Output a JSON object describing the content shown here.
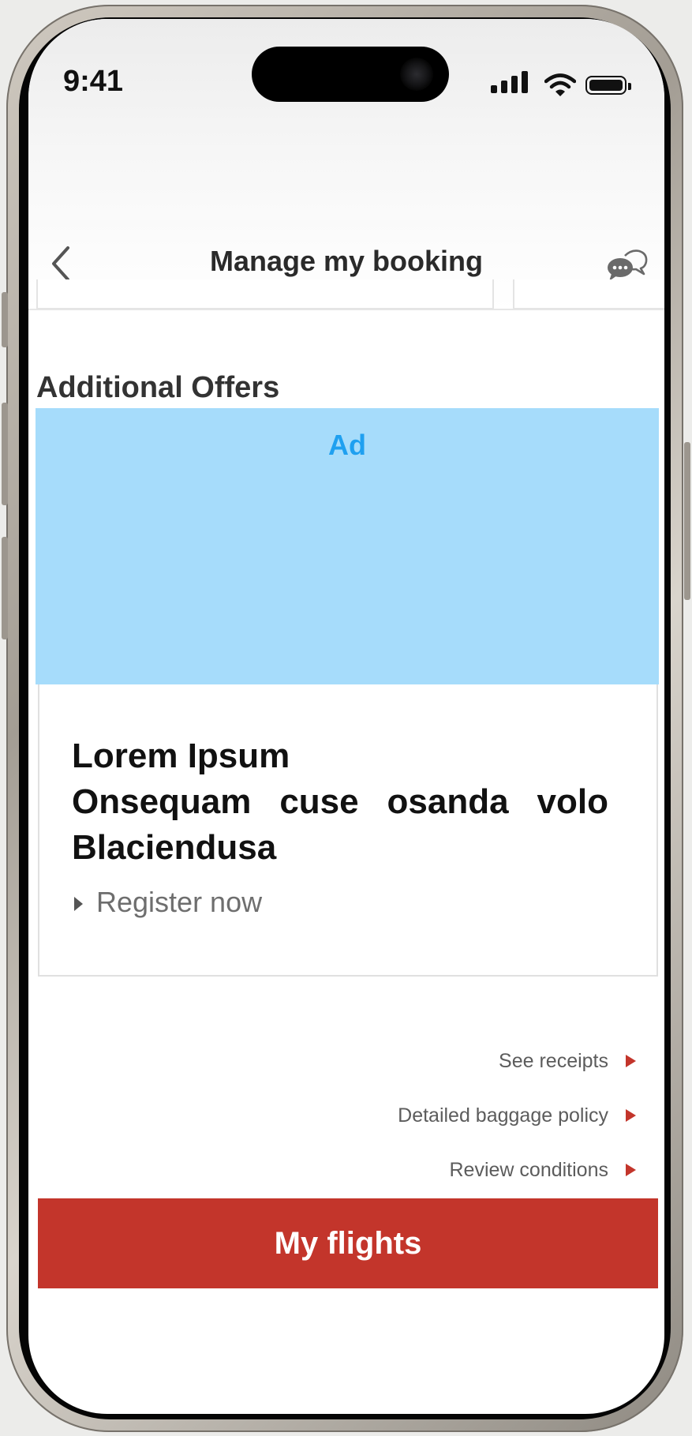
{
  "status_bar": {
    "time": "9:41",
    "icons": [
      "cellular-signal-icon",
      "wifi-icon",
      "battery-icon"
    ]
  },
  "nav": {
    "title": "Manage my booking",
    "back_icon": "chevron-left-icon",
    "chat_icon": "chat-bubbles-icon"
  },
  "section": {
    "title": "Additional Offers"
  },
  "ad": {
    "label": "Ad"
  },
  "offer": {
    "title": "Lorem Ipsum",
    "subtitle": "Onsequam cuse osanda volo Blaciendusa",
    "cta": "Register now"
  },
  "links": [
    {
      "label": "See receipts"
    },
    {
      "label": "Detailed baggage policy"
    },
    {
      "label": "Review conditions"
    }
  ],
  "primary_button": {
    "label": "My flights"
  },
  "colors": {
    "accent": "#c3352b",
    "ad_background": "#a6dcfb",
    "ad_text": "#1fa0f0"
  }
}
